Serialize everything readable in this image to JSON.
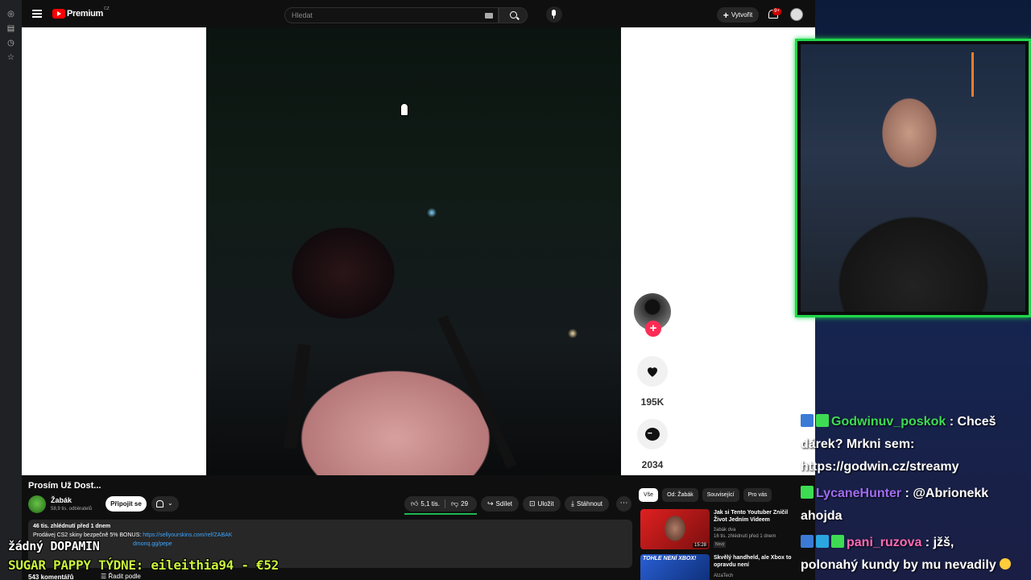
{
  "header": {
    "logo_text": "Premium",
    "logo_region": "CZ",
    "search_placeholder": "Hledat",
    "create_label": "Vytvořit",
    "notification_count": "9+"
  },
  "video": {
    "likes_count": "195K",
    "comments_count": "2034"
  },
  "meta": {
    "title": "Prosím Už Dost...",
    "channel_name": "Žabák",
    "channel_subs": "58,9 tis. odběratelů",
    "join_label": "Připojit se",
    "like_count": "5,1 tis.",
    "dislike_count": "29",
    "share_label": "Sdílet",
    "save_label": "Uložit",
    "download_label": "Stáhnout"
  },
  "description": {
    "stats": "46 tis. zhlédnutí  před 1 dnem",
    "line2_text": "Prodávej CS2 skiny bezpečně 5% BONUS: ",
    "line2_link": "https://sellyourskins.com/ref/ZABAK",
    "line3_link": "dmonq.gg/pepe"
  },
  "comments": {
    "count_label": "543 komentářů",
    "sort_label": "Řadit podle"
  },
  "recommendations": {
    "chips": [
      "Vše",
      "Od: Žabák",
      "Související",
      "Pro vás"
    ],
    "items": [
      {
        "title": "Jak si Tento Youtuber Zničil Život Jedním Videem",
        "channel": "žabák dva",
        "meta": "16 tis. zhlédnutí  před 1 dnem",
        "badge": "Nový",
        "duration": "15:28"
      },
      {
        "title": "Skvělý handheld, ale Xbox to opravdu není",
        "channel": "AlzaTech",
        "thumb_text": "TOHLE NENÍ XBOX!"
      }
    ]
  },
  "overlays": {
    "line1": "žádný DOPAMIN",
    "line2": "SUGAR PAPPY TÝDNE: eileithia94 - €52"
  },
  "chat": [
    {
      "user": "Godwinuv_poskok",
      "user_color": "#3ddc53",
      "message_parts": [
        " : Chceš",
        "dárek? Mrkni sem:",
        "https://godwin.cz/streamy"
      ]
    },
    {
      "user": "LycaneHunter",
      "user_color": "#a06cf0",
      "message_parts": [
        " : @Abrionekk",
        "ahojda"
      ]
    },
    {
      "user": "pani_ruzova",
      "user_color": "#ff69b4",
      "message_parts": [
        " : jžš,",
        "polonahý kundy by mu nevadily"
      ]
    }
  ],
  "colors": {
    "yt_bg": "#0f0f0f",
    "tiktok_pink": "#fe2c55",
    "webcam_border": "#1fd64a",
    "overlay_yellow": "#c9f23c"
  }
}
